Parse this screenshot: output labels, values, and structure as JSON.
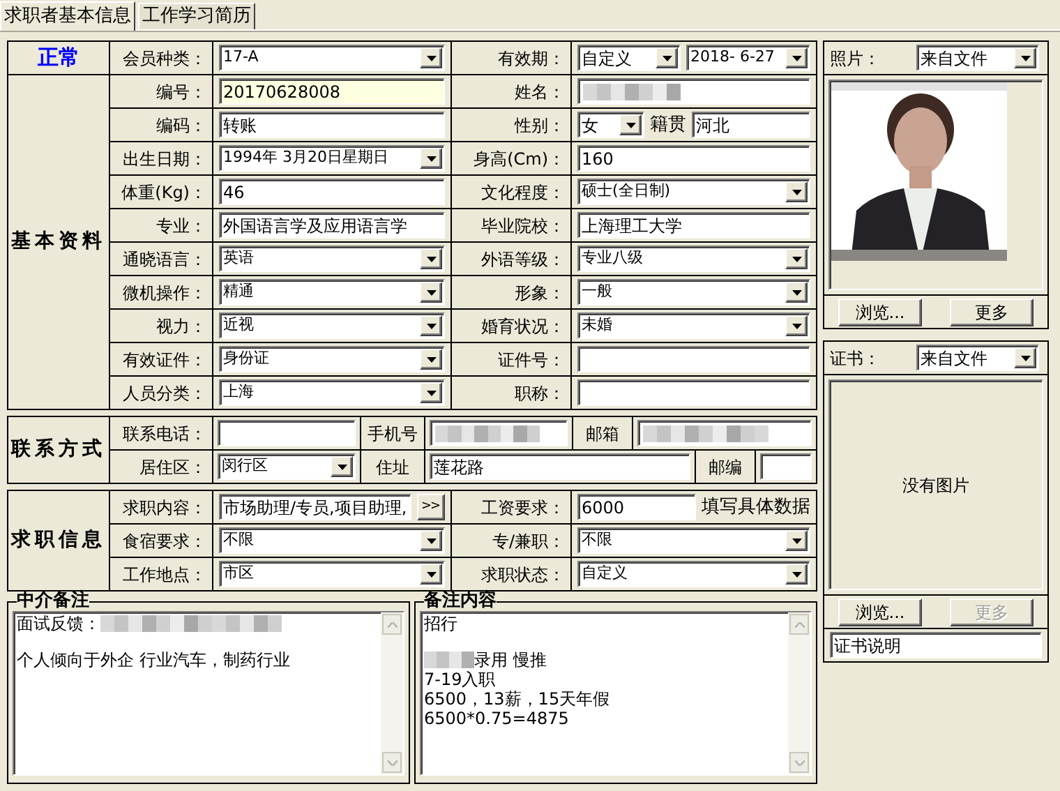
{
  "tabs": [
    {
      "label": "求职者基本信息",
      "selected": true
    },
    {
      "label": "工作学习简历",
      "selected": false
    }
  ],
  "status": "正常",
  "member_row": {
    "left": {
      "label": "会员种类：",
      "fields": [
        {
          "kind": "combo",
          "value": "17-A"
        }
      ]
    },
    "right": {
      "label": "有效期：",
      "fields": [
        {
          "kind": "combo",
          "value": "自定义"
        },
        {
          "kind": "combo",
          "value": "2018- 6-27"
        }
      ]
    }
  },
  "basic": {
    "title": "基本资料",
    "rows": [
      {
        "left": {
          "label": "编号：",
          "fields": [
            {
              "kind": "highlight_input",
              "value": "20170628008"
            }
          ]
        },
        "right": {
          "label": "姓名：",
          "fields": [
            {
              "kind": "blurred"
            }
          ]
        }
      },
      {
        "left": {
          "label": "编码：",
          "fields": [
            {
              "kind": "input",
              "value": "转账"
            }
          ]
        },
        "right": {
          "label": "性别：",
          "fields": [
            {
              "kind": "combo",
              "value": "女"
            },
            {
              "kind": "caption",
              "text": "籍贯"
            },
            {
              "kind": "input",
              "value": "河北"
            }
          ]
        }
      },
      {
        "left": {
          "label": "出生日期：",
          "fields": [
            {
              "kind": "combo",
              "value": "1994年 3月20日星期日"
            }
          ]
        },
        "right": {
          "label": "身高(Cm)：",
          "fields": [
            {
              "kind": "input",
              "value": "160"
            }
          ]
        }
      },
      {
        "left": {
          "label": "体重(Kg)：",
          "fields": [
            {
              "kind": "input",
              "value": "46"
            }
          ]
        },
        "right": {
          "label": "文化程度：",
          "fields": [
            {
              "kind": "combo",
              "value": "硕士(全日制)"
            }
          ]
        }
      },
      {
        "left": {
          "label": "专业：",
          "fields": [
            {
              "kind": "input",
              "value": "外国语言学及应用语言学"
            }
          ]
        },
        "right": {
          "label": "毕业院校：",
          "fields": [
            {
              "kind": "input",
              "value": "上海理工大学"
            }
          ]
        }
      },
      {
        "left": {
          "label": "通晓语言：",
          "fields": [
            {
              "kind": "combo",
              "value": "英语"
            }
          ]
        },
        "right": {
          "label": "外语等级：",
          "fields": [
            {
              "kind": "combo",
              "value": "专业八级"
            }
          ]
        }
      },
      {
        "left": {
          "label": "微机操作：",
          "fields": [
            {
              "kind": "combo",
              "value": "精通"
            }
          ]
        },
        "right": {
          "label": "形象：",
          "fields": [
            {
              "kind": "combo",
              "value": "一般"
            }
          ]
        }
      },
      {
        "left": {
          "label": "视力：",
          "fields": [
            {
              "kind": "combo",
              "value": "近视"
            }
          ]
        },
        "right": {
          "label": "婚育状况：",
          "fields": [
            {
              "kind": "combo",
              "value": "未婚"
            }
          ]
        }
      },
      {
        "left": {
          "label": "有效证件：",
          "fields": [
            {
              "kind": "combo",
              "value": "身份证"
            }
          ]
        },
        "right": {
          "label": "证件号：",
          "fields": [
            {
              "kind": "input"
            }
          ]
        }
      },
      {
        "left": {
          "label": "人员分类：",
          "fields": [
            {
              "kind": "combo",
              "value": "上海"
            }
          ]
        },
        "right": {
          "label": "职称：",
          "fields": [
            {
              "kind": "input"
            }
          ]
        }
      }
    ]
  },
  "contact": {
    "title": "联系方式",
    "rows": [
      [
        {
          "kind": "label",
          "text": "联系电话："
        },
        {
          "kind": "input"
        },
        {
          "kind": "label",
          "text": "手机号"
        },
        {
          "kind": "blurred"
        },
        {
          "kind": "label",
          "text": "邮箱"
        },
        {
          "kind": "blurred"
        }
      ],
      [
        {
          "kind": "label",
          "text": "居住区："
        },
        {
          "kind": "combo",
          "value": "闵行区"
        },
        {
          "kind": "label",
          "text": "住址"
        },
        {
          "kind": "input",
          "value": "莲花路"
        },
        {
          "kind": "label",
          "text": "邮编"
        },
        {
          "kind": "input"
        }
      ]
    ]
  },
  "job": {
    "title": "求职信息",
    "rows": [
      {
        "left": {
          "label": "求职内容：",
          "fields": [
            {
              "kind": "input",
              "value": "市场助理/专员,项目助理,"
            },
            {
              "kind": "button",
              "text": ">>"
            }
          ]
        },
        "right": {
          "label": "工资要求：",
          "fields": [
            {
              "kind": "input",
              "value": "6000"
            },
            {
              "kind": "caption",
              "text": "填写具体数据"
            }
          ]
        }
      },
      {
        "left": {
          "label": "食宿要求：",
          "fields": [
            {
              "kind": "combo",
              "value": "不限"
            }
          ]
        },
        "right": {
          "label": "专/兼职：",
          "fields": [
            {
              "kind": "combo",
              "value": "不限"
            }
          ]
        }
      },
      {
        "left": {
          "label": "工作地点：",
          "fields": [
            {
              "kind": "combo",
              "value": "市区"
            }
          ]
        },
        "right": {
          "label": "求职状态：",
          "fields": [
            {
              "kind": "combo",
              "value": "自定义"
            }
          ]
        }
      }
    ]
  },
  "agency_notes": {
    "title": "中介备注",
    "paragraphs": [
      [
        {
          "parts": [
            {
              "kind": "text",
              "text": "面试反馈："
            },
            {
              "kind": "blurred"
            }
          ]
        }
      ],
      [
        {
          "parts": [
            {
              "kind": "text",
              "text": "个人倾向于外企 行业汽车，制药行业"
            }
          ]
        }
      ]
    ]
  },
  "remarks": {
    "title": "备注内容",
    "paragraphs": [
      [
        {
          "parts": [
            {
              "kind": "text",
              "text": "招行"
            }
          ]
        }
      ],
      [
        {
          "parts": [
            {
              "kind": "blurred"
            },
            {
              "kind": "text",
              "text": "录用 慢推"
            }
          ]
        },
        {
          "parts": [
            {
              "kind": "text",
              "text": "7-19入职"
            }
          ]
        },
        {
          "parts": [
            {
              "kind": "text",
              "text": "6500，13薪，15天年假"
            }
          ]
        },
        {
          "parts": [
            {
              "kind": "text",
              "text": "6500*0.75=4875"
            }
          ]
        }
      ]
    ]
  },
  "photo": {
    "label": "照片：",
    "source": "来自文件",
    "buttons": [
      {
        "text": "浏览...",
        "disabled": false
      },
      {
        "text": "更多",
        "disabled": false
      }
    ]
  },
  "certificate": {
    "label": "证书：",
    "source": "来自文件",
    "empty_text": "没有图片",
    "buttons": [
      {
        "text": "浏览...",
        "disabled": false
      },
      {
        "text": "更多",
        "disabled": true
      }
    ],
    "caption": "证书说明"
  }
}
